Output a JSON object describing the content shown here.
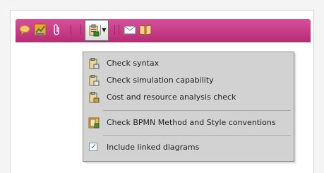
{
  "toolbar": {
    "accent_color": "#c93e8a",
    "icons": [
      "comment-icon",
      "chart-icon",
      "paperclip-icon",
      "validation-dropdown-icon",
      "mail-icon",
      "book-icon"
    ]
  },
  "menu": {
    "items": [
      {
        "label": "Check syntax",
        "icon": "check-syntax-icon"
      },
      {
        "label": "Check simulation capability",
        "icon": "check-simulation-icon"
      },
      {
        "label": "Cost and resource analysis check",
        "icon": "cost-analysis-icon"
      },
      {
        "label": "Check BPMN Method and Style conventions",
        "icon": "bpmn-check-icon"
      }
    ],
    "checkbox": {
      "label": "Include linked diagrams",
      "checked": true
    }
  }
}
